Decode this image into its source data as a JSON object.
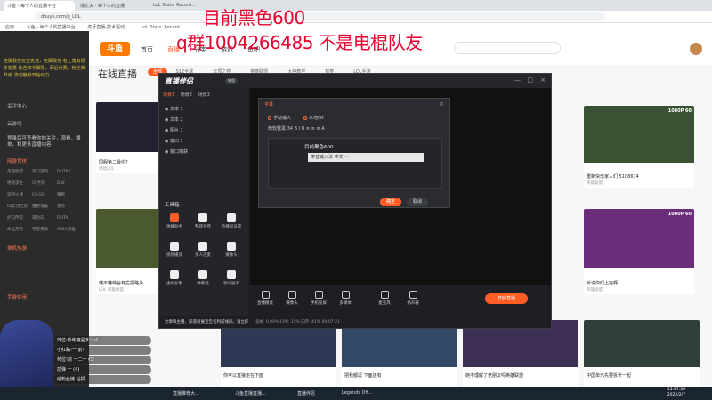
{
  "browser": {
    "tabs": [
      "斗鱼 - 每个人的直播平台",
      "撸丈夫 - 每个人的直播",
      "LoL Stats, Record..."
    ],
    "address": "douyu.com/g_LOL",
    "bookmarks": [
      "应用",
      "斗鱼 - 每个人的直播平台",
      "虎牙直播-技术驱动...",
      "LoL Stats, Record..."
    ]
  },
  "overlay": {
    "title": "目前黑色600",
    "qq_line": "q群1004266485  不是电棍队友"
  },
  "douyu_nav": {
    "logo": "斗鱼",
    "items": [
      "首页",
      "直播",
      "分类",
      "游戏",
      "鱼吧"
    ],
    "active_index": 1
  },
  "sidebar": {
    "banner": "左脚我在玩宝克住，左脚我在 右上角有很多能量 比苦掉手脚累，而后续费，粉丝牌升级 流动静默开始动力",
    "menu": [
      "关注中心",
      "云游戏"
    ],
    "notice": "登录后可查看你的关注，观看，播单，和更多直播内容",
    "section_title": "网游竞技",
    "grid": [
      "英雄联盟",
      "热门游戏",
      "DOTA2",
      "绝地求生",
      "CF手游",
      "DNF",
      "穿越火线",
      "CS:GO",
      "魔兽",
      "lol云顶之弈",
      "魔兽争霸",
      "星际",
      "炉石传说",
      "冒险岛",
      "DOTA",
      "命运方舟",
      "守望先锋",
      "APEX英雄"
    ],
    "section2": "单机热游",
    "section3": "手游休闲"
  },
  "main": {
    "title": "在线直播",
    "categories": [
      "全部",
      "S12全球",
      "云顶之弈",
      "英雄联盟",
      "大神教学",
      "搞笑",
      "LOL手游"
    ],
    "cards": [
      {
        "caption": "国服第二最伦?",
        "sub": "哈哈LOL"
      },
      {
        "caption": "重新快乐家人们 5108674",
        "sub": "英雄联盟",
        "hd": "1080P 60"
      },
      {
        "caption": "懂不懂峡谷有拦把路头",
        "sub": "LOL 英雄联盟"
      },
      {
        "caption": "听说你们上完啊",
        "sub": "英雄联盟",
        "hd": "1080P 60"
      },
      {
        "caption": "你可以直接走在下面",
        "sub": "英雄联盟"
      },
      {
        "caption": "把我都逗 下面还有",
        "sub": "英雄联盟"
      },
      {
        "caption": "她不理解了老朋友吗英雄联盟",
        "sub": "英雄联盟"
      },
      {
        "caption": "中国单元先要拆卡一起",
        "sub": "英雄联盟"
      }
    ]
  },
  "app": {
    "name": "直播伴侣",
    "version": "新版",
    "scene_tabs": [
      "场景1",
      "场景2",
      "场景3"
    ],
    "sources": [
      "文本 1",
      "文本 2",
      "图片 1",
      "窗口 1",
      "窗口捕获"
    ],
    "tool_title": "工具箱",
    "tools": [
      "弹幕助手",
      "整理宣传",
      "直播间设置",
      "视频播放",
      "多人连麦",
      "摄像头",
      "虚拟形象",
      "弹幕墙",
      "歌词展示"
    ],
    "bottom": [
      "直播模式",
      "摄像头",
      "手机投屏",
      "多媒体",
      "麦克风",
      "扬声器"
    ],
    "live_button": "开始直播",
    "status": "丢帧: 0.00%   CPU: 15%   内存: 41%   00:07:21",
    "notice": "文章快主播，知道发展宣告名利前线间，请立即联络与官组首"
  },
  "dialog": {
    "title": "字幕",
    "radios": [
      "手动输入",
      "本地txt"
    ],
    "tools": "微软雅黑   34   B  I  U  ≡  ≡  ≡  A",
    "text": "目前黑色600",
    "input": "拼音输入法 中文 ···",
    "ok": "确定",
    "cancel": "取消"
  },
  "chat": [
    "帅位:新练魔晶多一点",
    "小红路!一 前!",
    "帅位!前 一二一 红!",
    "前弹 一 (4)",
    "给粉丝链 钻机"
  ],
  "taskbar": {
    "items": [
      "直播推荐大...",
      "斗鱼直播直播...",
      "直播伴侣",
      "Legends Off..."
    ],
    "time": "15:47:36",
    "date": "2022/2/7"
  }
}
